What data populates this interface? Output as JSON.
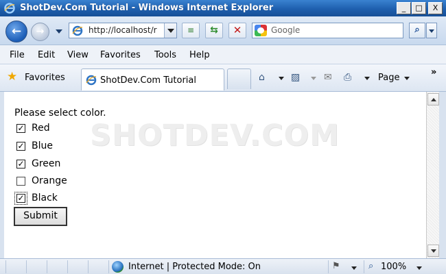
{
  "window": {
    "title": "ShotDev.Com Tutorial - Windows Internet Explorer",
    "minimize": "_",
    "maximize": "□",
    "close": "X"
  },
  "address_bar": {
    "url": "http://localhost/r",
    "search_placeholder": "Google"
  },
  "menu": [
    "File",
    "Edit",
    "View",
    "Favorites",
    "Tools",
    "Help"
  ],
  "favorites_bar": {
    "favorites_label": "Favorites",
    "tab_title": "ShotDev.Com Tutorial",
    "page_menu": "Page",
    "chevron": "»"
  },
  "page": {
    "watermark": "SHOTDEV.COM",
    "prompt": "Please select color.",
    "options": [
      {
        "label": "Red",
        "checked": true
      },
      {
        "label": "Blue",
        "checked": true
      },
      {
        "label": "Green",
        "checked": true
      },
      {
        "label": "Orange",
        "checked": false
      },
      {
        "label": "Black",
        "checked": true,
        "focused": true
      }
    ],
    "submit_label": "Submit"
  },
  "status_bar": {
    "zone_text": "Internet | Protected Mode: On",
    "zoom": "100%"
  },
  "icons": {
    "back": "arrow-left-icon",
    "forward": "arrow-right-icon",
    "refresh": "refresh-icon",
    "stop": "stop-icon",
    "search": "search-icon",
    "home": "home-icon",
    "feeds": "rss-icon",
    "mail": "mail-icon",
    "print": "print-icon"
  },
  "colors": {
    "titlebar": "#1e5fae",
    "toolbar": "#dfe9f6"
  }
}
